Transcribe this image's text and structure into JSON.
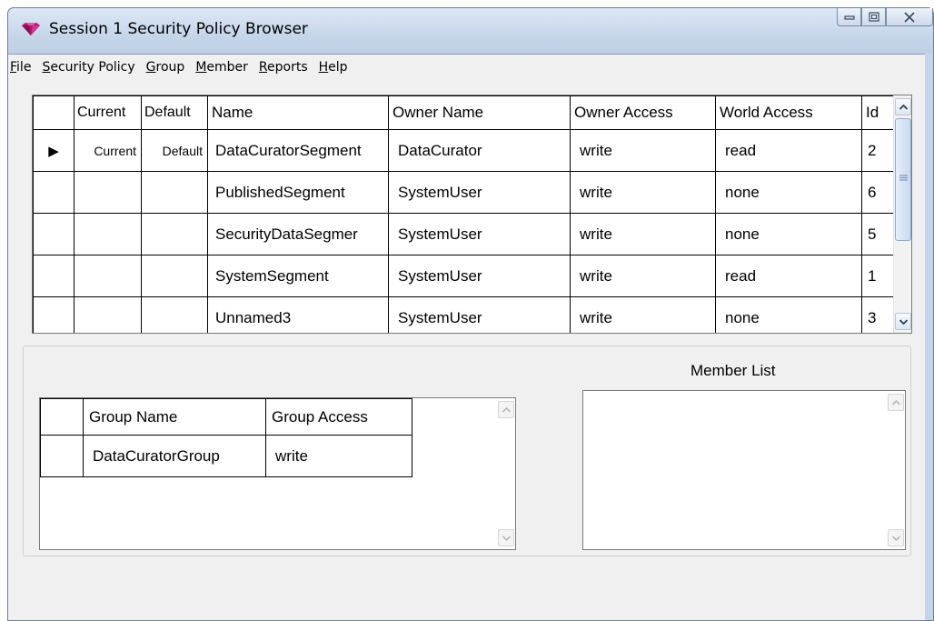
{
  "window": {
    "title": "Session 1 Security Policy Browser",
    "accent": "#c5d4e7"
  },
  "menu": [
    {
      "label": "File",
      "mnemonic": "F",
      "rest": "ile"
    },
    {
      "label": "Security Policy",
      "mnemonic": "S",
      "rest": "ecurity Policy"
    },
    {
      "label": "Group",
      "mnemonic": "G",
      "rest": "roup"
    },
    {
      "label": "Member",
      "mnemonic": "M",
      "rest": "ember"
    },
    {
      "label": "Reports",
      "mnemonic": "R",
      "rest": "eports"
    },
    {
      "label": "Help",
      "mnemonic": "H",
      "rest": "elp"
    }
  ],
  "segments": {
    "headers": [
      "",
      "Current",
      "Default",
      "Name",
      "Owner Name",
      "Owner Access",
      "World Access",
      "Id"
    ],
    "rows": [
      {
        "indicator": "▶",
        "current": "Current",
        "default": "Default",
        "name": "DataCuratorSegment",
        "owner": "DataCurator",
        "owner_access": "write",
        "world_access": "read",
        "id": "2"
      },
      {
        "indicator": "",
        "current": "",
        "default": "",
        "name": "PublishedSegment",
        "owner": "SystemUser",
        "owner_access": "write",
        "world_access": "none",
        "id": "6"
      },
      {
        "indicator": "",
        "current": "",
        "default": "",
        "name": "SecurityDataSegmer",
        "owner": "SystemUser",
        "owner_access": "write",
        "world_access": "none",
        "id": "5"
      },
      {
        "indicator": "",
        "current": "",
        "default": "",
        "name": "SystemSegment",
        "owner": "SystemUser",
        "owner_access": "write",
        "world_access": "read",
        "id": "1"
      },
      {
        "indicator": "",
        "current": "",
        "default": "",
        "name": "Unnamed3",
        "owner": "SystemUser",
        "owner_access": "write",
        "world_access": "none",
        "id": "3"
      }
    ]
  },
  "groups": {
    "headers": [
      "",
      "Group Name",
      "Group Access"
    ],
    "rows": [
      {
        "indicator": "",
        "name": "DataCuratorGroup",
        "access": "write"
      }
    ]
  },
  "member_list": {
    "label": "Member List",
    "items": []
  },
  "icons": {
    "app": "gemstone-icon",
    "minimize": "minimize-icon",
    "maximize": "maximize-icon",
    "close": "close-icon"
  }
}
